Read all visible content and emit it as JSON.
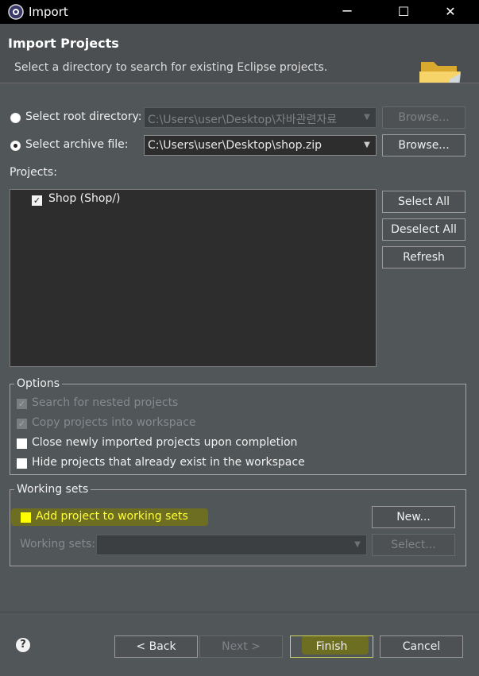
{
  "window": {
    "title": "Import",
    "controls": {
      "minimize": "─",
      "maximize": "☐",
      "close": "✕"
    }
  },
  "header": {
    "title": "Import Projects",
    "subtitle": "Select a directory to search for existing Eclipse projects."
  },
  "source": {
    "root_label": "Select root directory:",
    "root_value": "C:\\Users\\user\\Desktop\\자바관련자료",
    "root_browse": "Browse...",
    "archive_label": "Select archive file:",
    "archive_value": "C:\\Users\\user\\Desktop\\shop.zip",
    "archive_browse": "Browse..."
  },
  "projects": {
    "label": "Projects:",
    "items": [
      {
        "label": "Shop (Shop/)",
        "checked": true
      }
    ],
    "select_all": "Select All",
    "deselect_all": "Deselect All",
    "refresh": "Refresh"
  },
  "options": {
    "legend": "Options",
    "nested": "Search for nested projects",
    "copy": "Copy projects into workspace",
    "close": "Close newly imported projects upon completion",
    "hide": "Hide projects that already exist in the workspace"
  },
  "working_sets": {
    "legend": "Working sets",
    "add": "Add project to working sets",
    "new_button": "New...",
    "sets_label": "Working sets:",
    "select_button": "Select..."
  },
  "footer": {
    "help": "?",
    "back": "< Back",
    "next": "Next >",
    "finish": "Finish",
    "cancel": "Cancel"
  },
  "colors": {
    "titlebar": "#000000",
    "header": "#4b4f52",
    "dialog": "#515658",
    "highlight": "#ffff00"
  }
}
